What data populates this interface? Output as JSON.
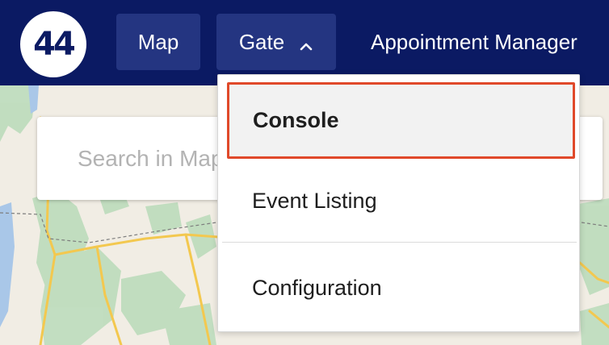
{
  "nav": {
    "logo_text": "44",
    "map_label": "Map",
    "gate_label": "Gate",
    "appointment_label": "Appointment Manager"
  },
  "search": {
    "placeholder": "Search in Map"
  },
  "dropdown": {
    "items": [
      {
        "label": "Console",
        "highlighted": true
      },
      {
        "label": "Event Listing"
      },
      {
        "label": "Configuration"
      }
    ]
  },
  "colors": {
    "nav_bg": "#0b1a63",
    "nav_button_bg": "#243581",
    "highlight_border": "#e0492a",
    "map_land": "#f1ede4",
    "map_green": "#bcdcbc",
    "map_road": "#f3c84f"
  },
  "icons": {
    "gate_chevron": "chevron-up-icon"
  }
}
